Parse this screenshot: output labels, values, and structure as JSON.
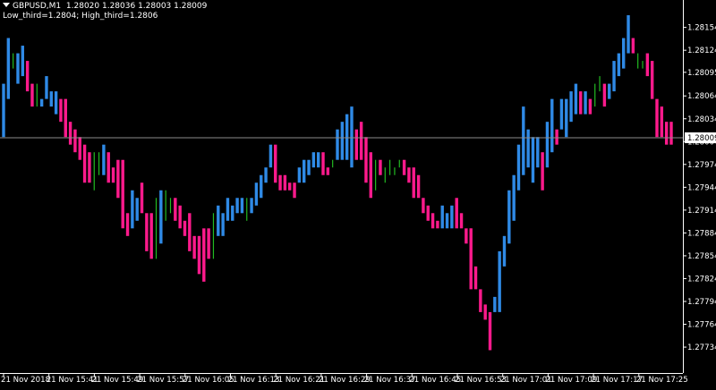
{
  "header": {
    "symbol": "GBPUSD,M1",
    "ohlc": "1.28020 1.28036 1.28003 1.28009",
    "indicator": "Low_third=1.2804; High_third=1.2806"
  },
  "colors": {
    "background": "#000000",
    "axis": "#ffffff",
    "up": "#2f8ae6",
    "down": "#ff1a8c",
    "neutral": "#22bb22",
    "price_line": "#8c8c8c"
  },
  "chart_data": {
    "type": "bar",
    "title": "",
    "ylim": [
      1.277,
      1.2819
    ],
    "grid": false,
    "y_ticks": [
      "1.28154",
      "1.28124",
      "1.28095",
      "1.28064",
      "1.28034",
      "1.28004",
      "1.27974",
      "1.27944",
      "1.27914",
      "1.27884",
      "1.27854",
      "1.27824",
      "1.27794",
      "1.27764",
      "1.27734"
    ],
    "x_ticks": [
      "21 Nov 2018",
      "21 Nov 15:41",
      "21 Nov 15:49",
      "21 Nov 15:57",
      "21 Nov 16:05",
      "21 Nov 16:13",
      "21 Nov 16:21",
      "21 Nov 16:29",
      "21 Nov 16:37",
      "21 Nov 16:45",
      "21 Nov 16:53",
      "21 Nov 17:01",
      "21 Nov 17:09",
      "21 Nov 17:17",
      "21 Nov 17:25"
    ],
    "current_price": "1.28009",
    "bars": [
      {
        "low": 1.2801,
        "high": 1.2808,
        "c": "up"
      },
      {
        "low": 1.2806,
        "high": 1.2814,
        "c": "up"
      },
      {
        "low": 1.281,
        "high": 1.2812,
        "c": "neutral"
      },
      {
        "low": 1.2808,
        "high": 1.2812,
        "c": "up"
      },
      {
        "low": 1.2809,
        "high": 1.2813,
        "c": "up"
      },
      {
        "low": 1.2807,
        "high": 1.2811,
        "c": "down"
      },
      {
        "low": 1.2805,
        "high": 1.2808,
        "c": "down"
      },
      {
        "low": 1.2805,
        "high": 1.2808,
        "c": "neutral"
      },
      {
        "low": 1.2805,
        "high": 1.2806,
        "c": "up"
      },
      {
        "low": 1.2806,
        "high": 1.2809,
        "c": "up"
      },
      {
        "low": 1.2805,
        "high": 1.2807,
        "c": "up"
      },
      {
        "low": 1.2804,
        "high": 1.2807,
        "c": "up"
      },
      {
        "low": 1.2803,
        "high": 1.2806,
        "c": "down"
      },
      {
        "low": 1.2801,
        "high": 1.2806,
        "c": "down"
      },
      {
        "low": 1.28,
        "high": 1.2803,
        "c": "down"
      },
      {
        "low": 1.2799,
        "high": 1.2802,
        "c": "down"
      },
      {
        "low": 1.2798,
        "high": 1.2801,
        "c": "down"
      },
      {
        "low": 1.2795,
        "high": 1.28,
        "c": "down"
      },
      {
        "low": 1.2795,
        "high": 1.2799,
        "c": "down"
      },
      {
        "low": 1.2794,
        "high": 1.2799,
        "c": "neutral"
      },
      {
        "low": 1.2796,
        "high": 1.2799,
        "c": "neutral"
      },
      {
        "low": 1.2796,
        "high": 1.28,
        "c": "up"
      },
      {
        "low": 1.2795,
        "high": 1.2799,
        "c": "down"
      },
      {
        "low": 1.2795,
        "high": 1.2797,
        "c": "down"
      },
      {
        "low": 1.2793,
        "high": 1.2798,
        "c": "down"
      },
      {
        "low": 1.2789,
        "high": 1.2798,
        "c": "down"
      },
      {
        "low": 1.2788,
        "high": 1.2791,
        "c": "down"
      },
      {
        "low": 1.2789,
        "high": 1.2794,
        "c": "up"
      },
      {
        "low": 1.279,
        "high": 1.2793,
        "c": "up"
      },
      {
        "low": 1.2791,
        "high": 1.2795,
        "c": "down"
      },
      {
        "low": 1.2786,
        "high": 1.2791,
        "c": "down"
      },
      {
        "low": 1.2785,
        "high": 1.2791,
        "c": "down"
      },
      {
        "low": 1.2785,
        "high": 1.2793,
        "c": "neutral"
      },
      {
        "low": 1.2787,
        "high": 1.2794,
        "c": "up"
      },
      {
        "low": 1.279,
        "high": 1.2794,
        "c": "neutral"
      },
      {
        "low": 1.2791,
        "high": 1.2793,
        "c": "neutral"
      },
      {
        "low": 1.279,
        "high": 1.2793,
        "c": "down"
      },
      {
        "low": 1.2789,
        "high": 1.2792,
        "c": "down"
      },
      {
        "low": 1.2788,
        "high": 1.279,
        "c": "down"
      },
      {
        "low": 1.2786,
        "high": 1.2791,
        "c": "down"
      },
      {
        "low": 1.2785,
        "high": 1.2788,
        "c": "down"
      },
      {
        "low": 1.2783,
        "high": 1.2788,
        "c": "down"
      },
      {
        "low": 1.2782,
        "high": 1.2789,
        "c": "down"
      },
      {
        "low": 1.2785,
        "high": 1.2789,
        "c": "down"
      },
      {
        "low": 1.2785,
        "high": 1.2791,
        "c": "neutral"
      },
      {
        "low": 1.2788,
        "high": 1.2792,
        "c": "up"
      },
      {
        "low": 1.2788,
        "high": 1.2791,
        "c": "up"
      },
      {
        "low": 1.279,
        "high": 1.2793,
        "c": "up"
      },
      {
        "low": 1.279,
        "high": 1.2792,
        "c": "up"
      },
      {
        "low": 1.2791,
        "high": 1.2793,
        "c": "up"
      },
      {
        "low": 1.2791,
        "high": 1.2793,
        "c": "up"
      },
      {
        "low": 1.279,
        "high": 1.2793,
        "c": "neutral"
      },
      {
        "low": 1.2791,
        "high": 1.2793,
        "c": "up"
      },
      {
        "low": 1.2792,
        "high": 1.2795,
        "c": "up"
      },
      {
        "low": 1.2793,
        "high": 1.2796,
        "c": "up"
      },
      {
        "low": 1.2795,
        "high": 1.2797,
        "c": "up"
      },
      {
        "low": 1.2797,
        "high": 1.28,
        "c": "up"
      },
      {
        "low": 1.2795,
        "high": 1.28,
        "c": "down"
      },
      {
        "low": 1.2794,
        "high": 1.2796,
        "c": "down"
      },
      {
        "low": 1.2794,
        "high": 1.2796,
        "c": "down"
      },
      {
        "low": 1.2794,
        "high": 1.2795,
        "c": "down"
      },
      {
        "low": 1.2793,
        "high": 1.2795,
        "c": "down"
      },
      {
        "low": 1.2795,
        "high": 1.2797,
        "c": "up"
      },
      {
        "low": 1.2795,
        "high": 1.2798,
        "c": "up"
      },
      {
        "low": 1.2796,
        "high": 1.2798,
        "c": "up"
      },
      {
        "low": 1.2797,
        "high": 1.2799,
        "c": "up"
      },
      {
        "low": 1.2797,
        "high": 1.2799,
        "c": "up"
      },
      {
        "low": 1.2796,
        "high": 1.2799,
        "c": "down"
      },
      {
        "low": 1.2796,
        "high": 1.2797,
        "c": "down"
      },
      {
        "low": 1.2797,
        "high": 1.2798,
        "c": "neutral"
      },
      {
        "low": 1.2798,
        "high": 1.2802,
        "c": "up"
      },
      {
        "low": 1.2798,
        "high": 1.2803,
        "c": "up"
      },
      {
        "low": 1.2798,
        "high": 1.2804,
        "c": "up"
      },
      {
        "low": 1.2797,
        "high": 1.2805,
        "c": "up"
      },
      {
        "low": 1.2798,
        "high": 1.2802,
        "c": "down"
      },
      {
        "low": 1.2798,
        "high": 1.2803,
        "c": "down"
      },
      {
        "low": 1.2795,
        "high": 1.2801,
        "c": "down"
      },
      {
        "low": 1.2793,
        "high": 1.2799,
        "c": "down"
      },
      {
        "low": 1.2794,
        "high": 1.2798,
        "c": "neutral"
      },
      {
        "low": 1.2796,
        "high": 1.2798,
        "c": "down"
      },
      {
        "low": 1.2795,
        "high": 1.2797,
        "c": "neutral"
      },
      {
        "low": 1.2796,
        "high": 1.2798,
        "c": "neutral"
      },
      {
        "low": 1.2796,
        "high": 1.2797,
        "c": "neutral"
      },
      {
        "low": 1.2797,
        "high": 1.2798,
        "c": "neutral"
      },
      {
        "low": 1.2796,
        "high": 1.2798,
        "c": "down"
      },
      {
        "low": 1.2795,
        "high": 1.2797,
        "c": "down"
      },
      {
        "low": 1.2793,
        "high": 1.2797,
        "c": "down"
      },
      {
        "low": 1.2793,
        "high": 1.2796,
        "c": "down"
      },
      {
        "low": 1.2791,
        "high": 1.2793,
        "c": "down"
      },
      {
        "low": 1.279,
        "high": 1.2792,
        "c": "down"
      },
      {
        "low": 1.2789,
        "high": 1.2791,
        "c": "down"
      },
      {
        "low": 1.2789,
        "high": 1.279,
        "c": "down"
      },
      {
        "low": 1.2789,
        "high": 1.2792,
        "c": "up"
      },
      {
        "low": 1.2789,
        "high": 1.2791,
        "c": "up"
      },
      {
        "low": 1.2789,
        "high": 1.2792,
        "c": "up"
      },
      {
        "low": 1.2789,
        "high": 1.2793,
        "c": "down"
      },
      {
        "low": 1.2789,
        "high": 1.2791,
        "c": "down"
      },
      {
        "low": 1.2787,
        "high": 1.2789,
        "c": "down"
      },
      {
        "low": 1.2781,
        "high": 1.2789,
        "c": "down"
      },
      {
        "low": 1.2781,
        "high": 1.2784,
        "c": "down"
      },
      {
        "low": 1.2778,
        "high": 1.2781,
        "c": "down"
      },
      {
        "low": 1.2777,
        "high": 1.2779,
        "c": "down"
      },
      {
        "low": 1.2773,
        "high": 1.2778,
        "c": "down"
      },
      {
        "low": 1.2778,
        "high": 1.278,
        "c": "up"
      },
      {
        "low": 1.2778,
        "high": 1.2786,
        "c": "up"
      },
      {
        "low": 1.2784,
        "high": 1.2788,
        "c": "up"
      },
      {
        "low": 1.2787,
        "high": 1.2794,
        "c": "up"
      },
      {
        "low": 1.279,
        "high": 1.2796,
        "c": "up"
      },
      {
        "low": 1.2794,
        "high": 1.28,
        "c": "up"
      },
      {
        "low": 1.2796,
        "high": 1.2805,
        "c": "up"
      },
      {
        "low": 1.2797,
        "high": 1.2802,
        "c": "up"
      },
      {
        "low": 1.2795,
        "high": 1.2801,
        "c": "up"
      },
      {
        "low": 1.2797,
        "high": 1.2801,
        "c": "up"
      },
      {
        "low": 1.2794,
        "high": 1.2799,
        "c": "down"
      },
      {
        "low": 1.2797,
        "high": 1.2803,
        "c": "up"
      },
      {
        "low": 1.2799,
        "high": 1.2806,
        "c": "up"
      },
      {
        "low": 1.28,
        "high": 1.2802,
        "c": "down"
      },
      {
        "low": 1.2802,
        "high": 1.2806,
        "c": "up"
      },
      {
        "low": 1.2801,
        "high": 1.2806,
        "c": "up"
      },
      {
        "low": 1.2803,
        "high": 1.2807,
        "c": "up"
      },
      {
        "low": 1.2804,
        "high": 1.2808,
        "c": "up"
      },
      {
        "low": 1.2804,
        "high": 1.2807,
        "c": "down"
      },
      {
        "low": 1.2804,
        "high": 1.2807,
        "c": "up"
      },
      {
        "low": 1.2804,
        "high": 1.2806,
        "c": "down"
      },
      {
        "low": 1.2805,
        "high": 1.2808,
        "c": "neutral"
      },
      {
        "low": 1.2807,
        "high": 1.2809,
        "c": "neutral"
      },
      {
        "low": 1.2805,
        "high": 1.2808,
        "c": "down"
      },
      {
        "low": 1.2806,
        "high": 1.2808,
        "c": "up"
      },
      {
        "low": 1.2807,
        "high": 1.2811,
        "c": "up"
      },
      {
        "low": 1.2809,
        "high": 1.2812,
        "c": "up"
      },
      {
        "low": 1.281,
        "high": 1.2814,
        "c": "up"
      },
      {
        "low": 1.2812,
        "high": 1.2817,
        "c": "up"
      },
      {
        "low": 1.2812,
        "high": 1.2814,
        "c": "down"
      },
      {
        "low": 1.281,
        "high": 1.2812,
        "c": "neutral"
      },
      {
        "low": 1.281,
        "high": 1.2811,
        "c": "neutral"
      },
      {
        "low": 1.2809,
        "high": 1.2812,
        "c": "down"
      },
      {
        "low": 1.2806,
        "high": 1.2811,
        "c": "down"
      },
      {
        "low": 1.2801,
        "high": 1.2806,
        "c": "down"
      },
      {
        "low": 1.2801,
        "high": 1.2805,
        "c": "down"
      },
      {
        "low": 1.28,
        "high": 1.2803,
        "c": "down"
      },
      {
        "low": 1.28,
        "high": 1.2803,
        "c": "down"
      }
    ]
  }
}
